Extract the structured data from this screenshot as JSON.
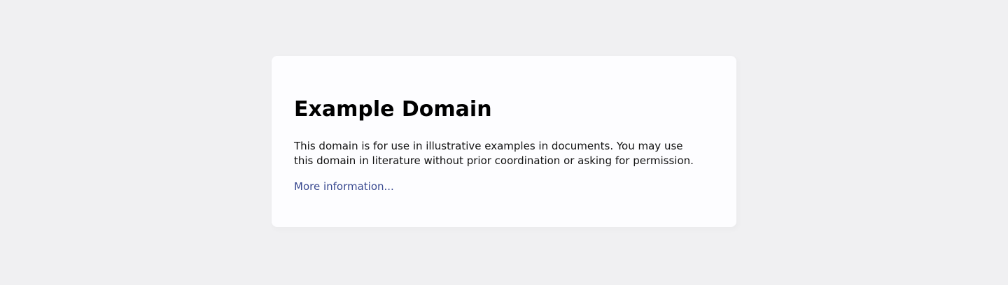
{
  "page": {
    "title": "Example Domain",
    "description": "This domain is for use in illustrative examples in documents. You may use this domain in literature without prior coordination or asking for permission.",
    "link_label": "More information..."
  },
  "colors": {
    "background": "#f0f0f2",
    "card": "#fdfdff",
    "link": "#38488f",
    "title": "#000000",
    "text": "#111111"
  }
}
